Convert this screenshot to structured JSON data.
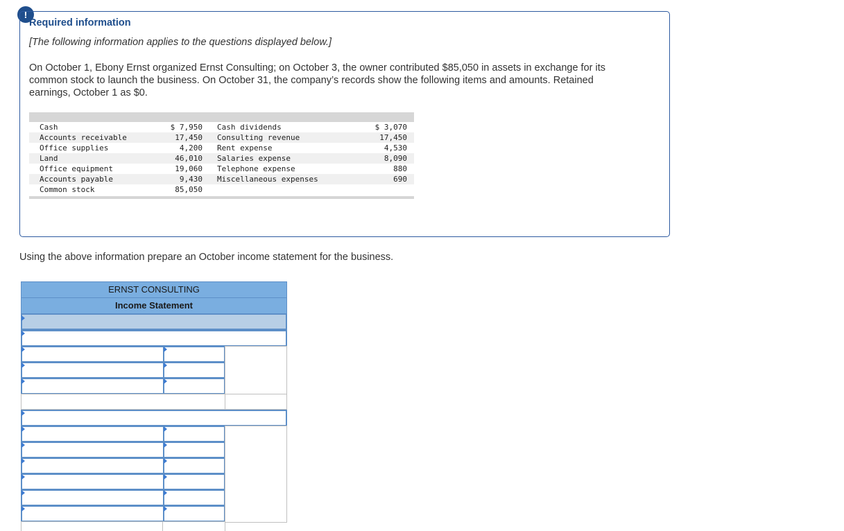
{
  "alert": {
    "icon": "exclamation-icon",
    "glyph": "!"
  },
  "info": {
    "title": "Required information",
    "subtitle": "[The following information applies to the questions displayed below.]",
    "paragraph": "On October 1, Ebony Ernst organized Ernst Consulting; on October 3, the owner contributed $85,050 in assets in exchange for its common stock to launch the business. On October 31, the company’s records show the following items and amounts. Retained earnings, October 1 as  $0."
  },
  "accounts": [
    {
      "left_label": "Cash",
      "left_value": "$ 7,950",
      "right_label": "Cash dividends",
      "right_value": "$ 3,070"
    },
    {
      "left_label": "Accounts receivable",
      "left_value": "17,450",
      "right_label": "Consulting revenue",
      "right_value": "17,450"
    },
    {
      "left_label": "Office supplies",
      "left_value": "4,200",
      "right_label": "Rent expense",
      "right_value": "4,530"
    },
    {
      "left_label": "Land",
      "left_value": "46,010",
      "right_label": "Salaries expense",
      "right_value": "8,090"
    },
    {
      "left_label": "Office equipment",
      "left_value": "19,060",
      "right_label": "Telephone expense",
      "right_value": "880"
    },
    {
      "left_label": "Accounts payable",
      "left_value": "9,430",
      "right_label": "Miscellaneous expenses",
      "right_value": "690"
    },
    {
      "left_label": "Common stock",
      "left_value": "85,050",
      "right_label": "",
      "right_value": ""
    }
  ],
  "question": "Using the above information prepare an October income statement for the business.",
  "statement": {
    "company": "ERNST CONSULTING",
    "title": "Income Statement",
    "date_value": "",
    "section_1_heading_value": "",
    "section_1_rows": [
      {
        "label": "",
        "amount": ""
      },
      {
        "label": "",
        "amount": ""
      },
      {
        "label": "",
        "amount": ""
      }
    ],
    "section_2_heading_value": "",
    "section_2_rows": [
      {
        "label": "",
        "amount": ""
      },
      {
        "label": "",
        "amount": ""
      },
      {
        "label": "",
        "amount": ""
      },
      {
        "label": "",
        "amount": ""
      },
      {
        "label": "",
        "amount": ""
      },
      {
        "label": "",
        "amount": ""
      }
    ]
  },
  "colors": {
    "accent": "#1f4e8c",
    "header_blue": "#7aaee0",
    "input_border": "#5d8fc8",
    "date_fill": "#b8cfe6"
  }
}
